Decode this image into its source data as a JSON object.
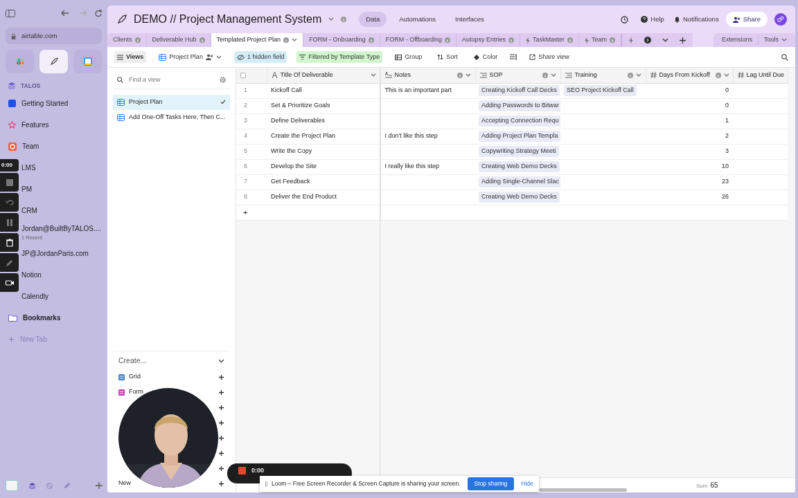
{
  "browser": {
    "url": "airtable.com",
    "pinned": [
      {
        "selected": false
      },
      {
        "selected": true
      },
      {
        "selected": false
      }
    ],
    "section": "TALOS",
    "items": [
      {
        "label": "Getting Started",
        "kind": "square",
        "color": "#1a4ff0"
      },
      {
        "label": "Features",
        "kind": "star",
        "color": "#e8457a"
      },
      {
        "label": "Team",
        "kind": "ring",
        "color": "#f0603a"
      },
      {
        "label": "LMS",
        "kind": "none"
      },
      {
        "label": "PM",
        "kind": "none"
      },
      {
        "label": "CRM",
        "kind": "none"
      },
      {
        "label": "Jordan@BuiltByTALOS....",
        "sub": "1 Recent",
        "kind": "none"
      },
      {
        "label": "JP@JordanParis.com",
        "kind": "none"
      },
      {
        "label": "Notion",
        "kind": "none"
      },
      {
        "label": "Calendly",
        "kind": "none"
      },
      {
        "label": "Bookmarks",
        "kind": "folder",
        "color": "#6a5fd0"
      }
    ],
    "new_tab": "New Tab"
  },
  "app": {
    "title": "DEMO // Project Management System",
    "nav": [
      {
        "label": "Data",
        "selected": true
      },
      {
        "label": "Automations",
        "selected": false
      },
      {
        "label": "Interfaces",
        "selected": false
      }
    ],
    "help": "Help",
    "notifications": "Notifications",
    "share": "Share"
  },
  "tables": [
    {
      "label": "Clients",
      "selected": false,
      "kind": "plain"
    },
    {
      "label": "Deliverable Hub",
      "selected": false,
      "kind": "plain"
    },
    {
      "label": "Templated Project Plan",
      "selected": true,
      "kind": "plain"
    },
    {
      "label": "FORM - Onboarding",
      "selected": false,
      "kind": "plain"
    },
    {
      "label": "FORM - Offboarding",
      "selected": false,
      "kind": "plain"
    },
    {
      "label": "Autopsy Entries",
      "selected": false,
      "kind": "plain"
    },
    {
      "label": "TaskMaster",
      "selected": false,
      "kind": "bolt"
    },
    {
      "label": "Team",
      "selected": false,
      "kind": "bolt"
    }
  ],
  "extensions": "Extensions",
  "tools": "Tools",
  "toolbar": {
    "views": "Views",
    "view_name": "Project Plan",
    "hidden": "1 hidden field",
    "filter": "Filtered by Template Type",
    "group": "Group",
    "sort": "Sort",
    "color_label": "Color",
    "share_view": "Share view"
  },
  "views_panel": {
    "placeholder": "Find a view",
    "views": [
      {
        "label": "Project Plan",
        "selected": true
      },
      {
        "label": "Add One-Off Tasks Here, Then C...",
        "selected": false
      }
    ],
    "create": "Create...",
    "create_items": [
      {
        "label": "Grid",
        "color": "#3b82c8"
      },
      {
        "label": "Form",
        "color": "#c236b8"
      },
      {
        "label": "New"
      }
    ]
  },
  "grid": {
    "all_selected": false,
    "columns": [
      {
        "label": "Title Of Deliverable",
        "kind": "text"
      },
      {
        "label": "Notes",
        "kind": "longtext"
      },
      {
        "label": "SOP",
        "kind": "link"
      },
      {
        "label": "Training",
        "kind": "link"
      },
      {
        "label": "Days From Kickoff",
        "kind": "number"
      },
      {
        "label": "Lag Until Due",
        "kind": "number"
      }
    ],
    "rows": [
      {
        "n": "1",
        "title": "Kickoff Call",
        "notes": "This is an important part",
        "sop": "Creating Kickoff Call Decks",
        "training": "SEO Project Kickoff Call",
        "days": "0"
      },
      {
        "n": "2",
        "title": "Set & Prioritize Goals",
        "sop": "Adding Passwords to Bitwar",
        "days": "0"
      },
      {
        "n": "3",
        "title": "Define Deliverables",
        "sop": "Accepting Connection Requ",
        "days": "1"
      },
      {
        "n": "4",
        "title": "Create the Project Plan",
        "notes": "I don't like this step",
        "sop": "Adding Project Plan Templa",
        "days": "2"
      },
      {
        "n": "5",
        "title": "Write the Copy",
        "sop": "Copywriting Strategy Meeti",
        "days": "3"
      },
      {
        "n": "6",
        "title": "Develop the Site",
        "notes": "I really like this step",
        "sop": "Creating Web Demo Decks",
        "days": "10"
      },
      {
        "n": "7",
        "title": "Get Feedback",
        "sop": "Adding Single-Channel Slac",
        "days": "23"
      },
      {
        "n": "8",
        "title": "Deliver the End Product",
        "sop": "Creating Web Demo Decks",
        "days": "26"
      }
    ],
    "add": "+",
    "sum_label": "Sum",
    "sum": "65"
  },
  "loom": {
    "side_timer": "0:00",
    "pill_timer": "0:00",
    "banner": "Loom – Free Screen Recorder & Screen Capture is sharing your screen.",
    "stop": "Stop sharing",
    "hide": "Hide"
  }
}
